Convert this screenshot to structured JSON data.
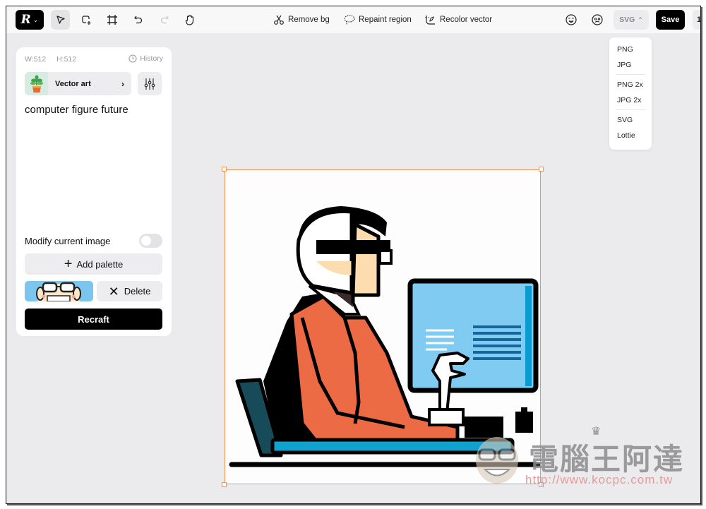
{
  "toolbar": {
    "logo_letter": "R",
    "tools": [
      "select",
      "add-frame",
      "crop",
      "undo",
      "redo",
      "hand"
    ],
    "ai_tools": [
      {
        "label": "Remove bg",
        "icon": "scissors-icon"
      },
      {
        "label": "Repaint region",
        "icon": "lasso-icon"
      },
      {
        "label": "Recolor vector",
        "icon": "recolor-icon"
      }
    ],
    "format_label": "SVG",
    "save_label": "Save",
    "more_label": "1"
  },
  "export_menu": {
    "groups": [
      [
        "PNG",
        "JPG"
      ],
      [
        "PNG 2x",
        "JPG 2x"
      ],
      [
        "SVG",
        "Lottie"
      ]
    ]
  },
  "panel": {
    "width_label": "W:512",
    "height_label": "H:512",
    "history_label": "History",
    "style_label": "Vector art",
    "prompt": "computer figure future",
    "modify_label": "Modify current image",
    "modify_enabled": false,
    "add_palette_label": "Add palette",
    "delete_label": "Delete",
    "recraft_label": "Recraft"
  },
  "canvas": {
    "image_description": "Vector art of a man with glasses sitting at a desk using a computer",
    "colors": {
      "shirt": "#ec6b45",
      "skin": "#fddcb0",
      "screen": "#7fcbf2",
      "screen_edge": "#0a9bd0",
      "desk": "#10a2cf",
      "chair": "#184b5a",
      "selection": "#f2945a"
    }
  },
  "watermark": {
    "title": "電腦王阿達",
    "url": "http://www.kocpc.com.tw"
  }
}
